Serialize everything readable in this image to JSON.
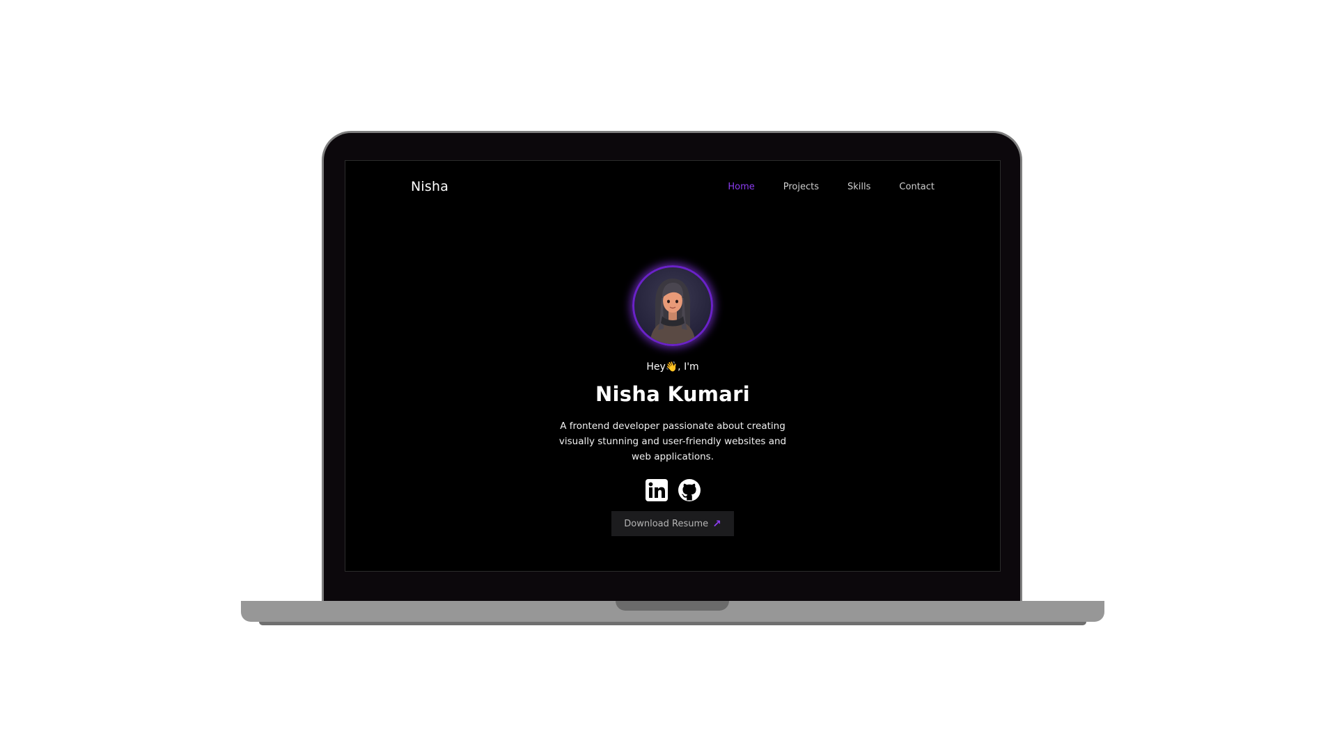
{
  "brand": "Nisha",
  "nav": {
    "items": [
      {
        "label": "Home",
        "active": true
      },
      {
        "label": "Projects",
        "active": false
      },
      {
        "label": "Skills",
        "active": false
      },
      {
        "label": "Contact",
        "active": false
      }
    ]
  },
  "hero": {
    "greeting": "Hey👋, I'm",
    "name": "Nisha Kumari",
    "bio": "A frontend developer passionate about creating visually stunning and user-friendly websites and web applications.",
    "avatar_icon": "avatar-3d-girl"
  },
  "socials": [
    {
      "icon": "linkedin-icon"
    },
    {
      "icon": "github-icon"
    }
  ],
  "resume_button": {
    "label": "Download Resume",
    "icon": "arrow-up-right-icon"
  },
  "colors": {
    "accent": "#8b3cf0",
    "background": "#000000",
    "bezel": "#0c080c",
    "laptop_base": "#979797",
    "button_bg": "#1c1c1e"
  }
}
